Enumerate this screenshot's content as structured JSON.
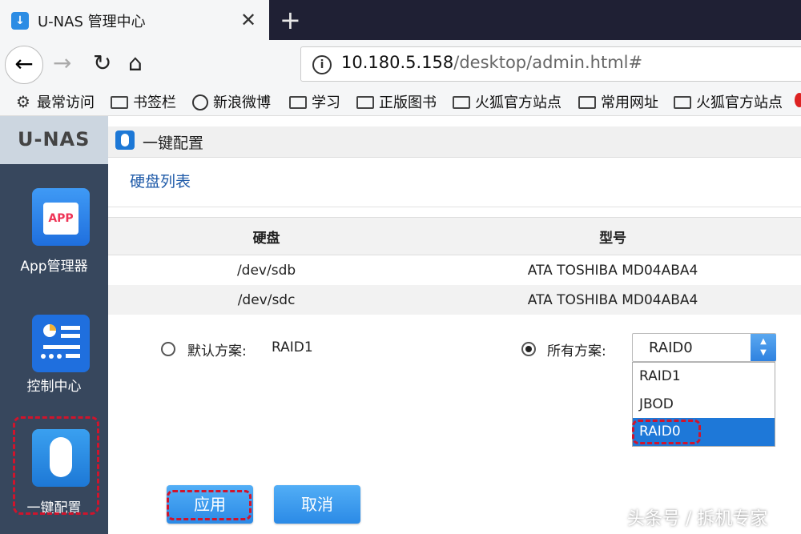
{
  "browser": {
    "tab_title": "U-NAS 管理中心",
    "url_host": "10.180.5.158",
    "url_path": "/desktop/admin.html#",
    "bookmarks": [
      "最常访问",
      "书签栏",
      "新浪微博",
      "学习",
      "正版图书",
      "火狐官方站点",
      "常用网址",
      "火狐官方站点"
    ]
  },
  "sidebar": {
    "brand": "U-NAS",
    "apps": [
      {
        "label": "App管理器",
        "icon": "app-store-icon"
      },
      {
        "label": "控制中心",
        "icon": "control-panel-icon"
      },
      {
        "label": "一键配置",
        "icon": "mouse-icon"
      }
    ]
  },
  "window": {
    "title": "一键配置",
    "section_title": "硬盘列表",
    "table": {
      "headers": [
        "硬盘",
        "型号"
      ],
      "rows": [
        [
          "/dev/sdb",
          "ATA TOSHIBA MD04ABA4"
        ],
        [
          "/dev/sdc",
          "ATA TOSHIBA MD04ABA4"
        ]
      ]
    },
    "default_option": {
      "label": "默认方案:",
      "value": "RAID1",
      "selected": false
    },
    "all_option": {
      "label": "所有方案:",
      "selected": true
    },
    "select": {
      "value": "RAID0",
      "options": [
        "RAID1",
        "JBOD",
        "RAID0"
      ]
    },
    "apply_label": "应用",
    "cancel_label": "取消"
  },
  "watermark": "头条号 / 拆机专家",
  "colors": {
    "sidebar": "#37475d",
    "accent": "#1e78d8",
    "highlight": "#d0142c"
  }
}
